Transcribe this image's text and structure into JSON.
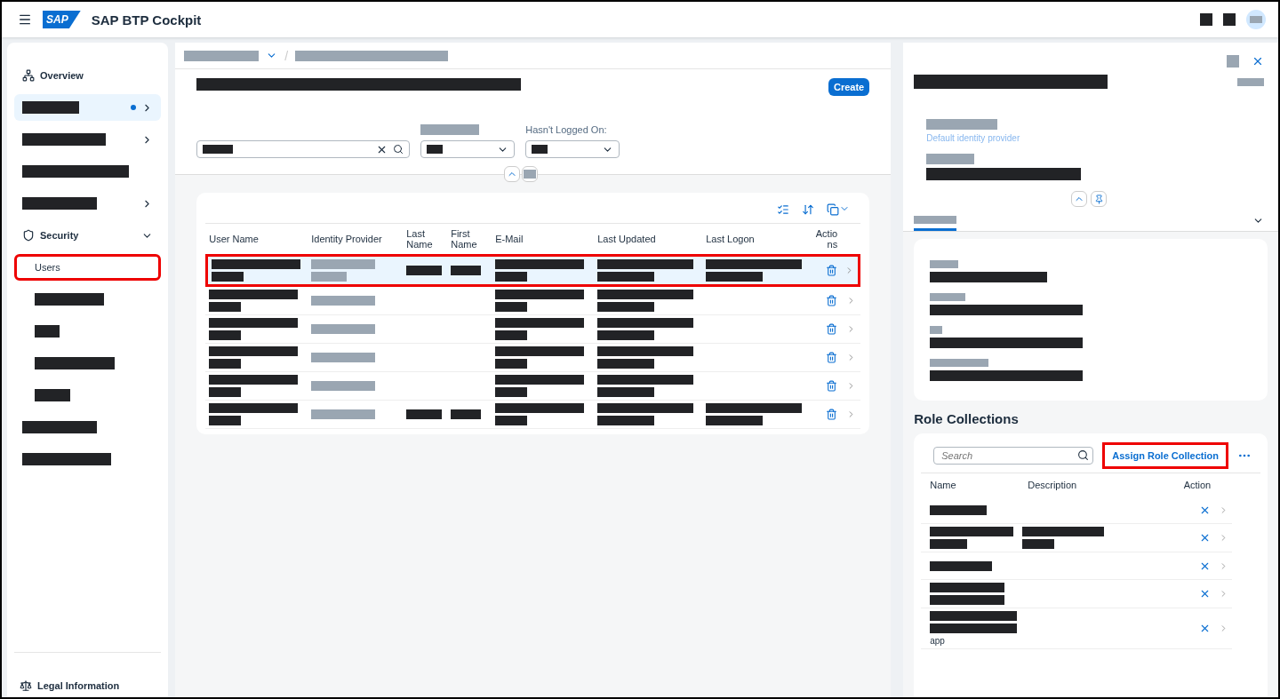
{
  "shell": {
    "title": "SAP BTP Cockpit",
    "logo": "SAP",
    "actions": [
      {
        "kind": "redacted",
        "greyed": false
      },
      {
        "kind": "redacted",
        "greyed": false
      },
      {
        "kind": "avatar"
      }
    ]
  },
  "sidebar": {
    "items": [
      {
        "kind": "overview",
        "label": "Overview",
        "selected": false
      },
      {
        "kind": "redacted",
        "greyed": false,
        "selected": true,
        "dot": true,
        "expandable": true,
        "expanded": false
      },
      {
        "kind": "redacted",
        "greyed": false,
        "selected": false,
        "expandable": true,
        "expanded": false
      },
      {
        "kind": "redacted",
        "greyed": false,
        "selected": false
      },
      {
        "kind": "redacted",
        "greyed": false,
        "selected": false,
        "expandable": true,
        "expanded": false
      },
      {
        "kind": "section",
        "label": "Security",
        "selected": false,
        "expandable": true,
        "expanded": true,
        "children": [
          {
            "kind": "text",
            "label": "Users",
            "selected": false,
            "highlighted": true
          },
          {
            "kind": "redacted",
            "greyed": false,
            "selected": false
          },
          {
            "kind": "redacted",
            "greyed": false,
            "selected": false
          },
          {
            "kind": "redacted",
            "greyed": false,
            "selected": false
          },
          {
            "kind": "redacted",
            "greyed": false,
            "selected": false
          }
        ]
      },
      {
        "kind": "redacted",
        "greyed": false,
        "selected": false
      },
      {
        "kind": "redacted",
        "greyed": false,
        "selected": false
      }
    ],
    "footer": {
      "label": "Legal Information"
    }
  },
  "main": {
    "breadcrumb": [
      {
        "greyed": true,
        "dropdown": true
      },
      {
        "greyed": true,
        "dropdown": false
      }
    ],
    "breadcrumb_separator": "/",
    "title": {
      "greyed": false
    },
    "create_button": "Create",
    "filters": [
      {
        "kind": "search",
        "value": {
          "greyed": false
        }
      },
      {
        "kind": "select",
        "label": {
          "kind": "redacted",
          "greyed": true
        },
        "value": {
          "greyed": false
        }
      },
      {
        "kind": "select",
        "label": {
          "kind": "text",
          "text": "Hasn't Logged On:"
        },
        "value": {
          "greyed": false
        }
      }
    ],
    "collapse_toggle": {
      "greyed": true
    },
    "table": {
      "columns": [
        "User Name",
        "Identity Provider",
        "Last Name",
        "First Name",
        "E-Mail",
        "Last Updated",
        "Last Logon",
        "Actions"
      ],
      "rows": [
        {
          "selected": true,
          "highlighted": true,
          "cells": [
            {
              "lines": [
                {
                  "greyed": false
                },
                {
                  "greyed": false
                }
              ]
            },
            {
              "lines": [
                {
                  "greyed": true
                },
                {
                  "greyed": true
                }
              ]
            },
            {
              "lines": [
                {
                  "greyed": false
                }
              ]
            },
            {
              "lines": [
                {
                  "greyed": false
                }
              ]
            },
            {
              "lines": [
                {
                  "greyed": false
                },
                {
                  "greyed": false
                }
              ]
            },
            {
              "lines": [
                {
                  "greyed": false
                },
                {
                  "greyed": false
                }
              ]
            },
            {
              "lines": [
                {
                  "greyed": false
                },
                {
                  "greyed": false
                }
              ]
            }
          ]
        },
        {
          "selected": false,
          "highlighted": false,
          "cells": [
            {
              "lines": [
                {
                  "greyed": false
                },
                {
                  "greyed": false
                }
              ]
            },
            {
              "lines": [
                {
                  "greyed": true
                }
              ]
            },
            {
              "empty": true
            },
            {
              "empty": true
            },
            {
              "lines": [
                {
                  "greyed": false
                },
                {
                  "greyed": false
                }
              ]
            },
            {
              "lines": [
                {
                  "greyed": false
                },
                {
                  "greyed": false
                }
              ]
            },
            {
              "empty": true
            }
          ]
        },
        {
          "selected": false,
          "highlighted": false,
          "cells": [
            {
              "lines": [
                {
                  "greyed": false
                },
                {
                  "greyed": false
                }
              ]
            },
            {
              "lines": [
                {
                  "greyed": true
                }
              ]
            },
            {
              "empty": true
            },
            {
              "empty": true
            },
            {
              "lines": [
                {
                  "greyed": false
                },
                {
                  "greyed": false
                }
              ]
            },
            {
              "lines": [
                {
                  "greyed": false
                },
                {
                  "greyed": false
                }
              ]
            },
            {
              "empty": true
            }
          ]
        },
        {
          "selected": false,
          "highlighted": false,
          "cells": [
            {
              "lines": [
                {
                  "greyed": false
                },
                {
                  "greyed": false
                }
              ]
            },
            {
              "lines": [
                {
                  "greyed": true
                }
              ]
            },
            {
              "empty": true
            },
            {
              "empty": true
            },
            {
              "lines": [
                {
                  "greyed": false
                },
                {
                  "greyed": false
                }
              ]
            },
            {
              "lines": [
                {
                  "greyed": false
                },
                {
                  "greyed": false
                }
              ]
            },
            {
              "empty": true
            }
          ]
        },
        {
          "selected": false,
          "highlighted": false,
          "cells": [
            {
              "lines": [
                {
                  "greyed": false
                },
                {
                  "greyed": false
                }
              ]
            },
            {
              "lines": [
                {
                  "greyed": true
                }
              ]
            },
            {
              "empty": true
            },
            {
              "empty": true
            },
            {
              "lines": [
                {
                  "greyed": false
                },
                {
                  "greyed": false
                }
              ]
            },
            {
              "lines": [
                {
                  "greyed": false
                },
                {
                  "greyed": false
                }
              ]
            },
            {
              "empty": true
            }
          ]
        },
        {
          "selected": false,
          "highlighted": false,
          "cells": [
            {
              "lines": [
                {
                  "greyed": false
                },
                {
                  "greyed": false
                }
              ]
            },
            {
              "lines": [
                {
                  "greyed": true
                }
              ]
            },
            {
              "lines": [
                {
                  "greyed": false
                }
              ]
            },
            {
              "lines": [
                {
                  "greyed": false
                }
              ]
            },
            {
              "lines": [
                {
                  "greyed": false
                },
                {
                  "greyed": false
                }
              ]
            },
            {
              "lines": [
                {
                  "greyed": false
                },
                {
                  "greyed": false
                }
              ]
            },
            {
              "lines": [
                {
                  "greyed": false
                },
                {
                  "greyed": false
                }
              ]
            }
          ]
        }
      ]
    }
  },
  "details": {
    "header_action": {
      "greyed": true
    },
    "title": {
      "greyed": false
    },
    "title_side": {
      "greyed": true
    },
    "fields": [
      {
        "label": {
          "greyed": true
        },
        "value": {
          "kind": "text",
          "text": "Default identity provider"
        }
      },
      {
        "label": {
          "greyed": true
        },
        "value": {
          "kind": "redacted",
          "greyed": false
        }
      }
    ],
    "tabs": [
      {
        "label": {
          "greyed": true
        },
        "selected": true
      }
    ],
    "info_card": [
      {
        "label": {
          "greyed": true
        },
        "value": {
          "greyed": false
        }
      },
      {
        "label": {
          "greyed": true
        },
        "value": {
          "greyed": false
        }
      },
      {
        "label": {
          "greyed": true
        },
        "value": {
          "greyed": false
        }
      },
      {
        "label": {
          "greyed": true
        },
        "value": {
          "greyed": false
        }
      }
    ],
    "role_collections": {
      "title": "Role Collections",
      "search": {
        "placeholder": "Search"
      },
      "assign_button": {
        "label": "Assign Role Collection",
        "highlighted": true
      },
      "columns": [
        "Name",
        "Description",
        "Action"
      ],
      "rows": [
        {
          "name": [
            {
              "kind": "redacted",
              "greyed": false
            }
          ]
        },
        {
          "name": [
            {
              "kind": "redacted",
              "greyed": false
            },
            {
              "kind": "redacted",
              "greyed": false
            }
          ],
          "description": [
            {
              "greyed": false
            },
            {
              "greyed": false
            }
          ]
        },
        {
          "name": [
            {
              "kind": "redacted",
              "greyed": false
            }
          ]
        },
        {
          "name": [
            {
              "kind": "redacted",
              "greyed": false
            },
            {
              "kind": "redacted",
              "greyed": false
            }
          ]
        },
        {
          "name": [
            {
              "kind": "redacted",
              "greyed": false
            },
            {
              "kind": "redacted",
              "greyed": false
            },
            {
              "kind": "text",
              "text": "app"
            }
          ]
        }
      ]
    }
  }
}
